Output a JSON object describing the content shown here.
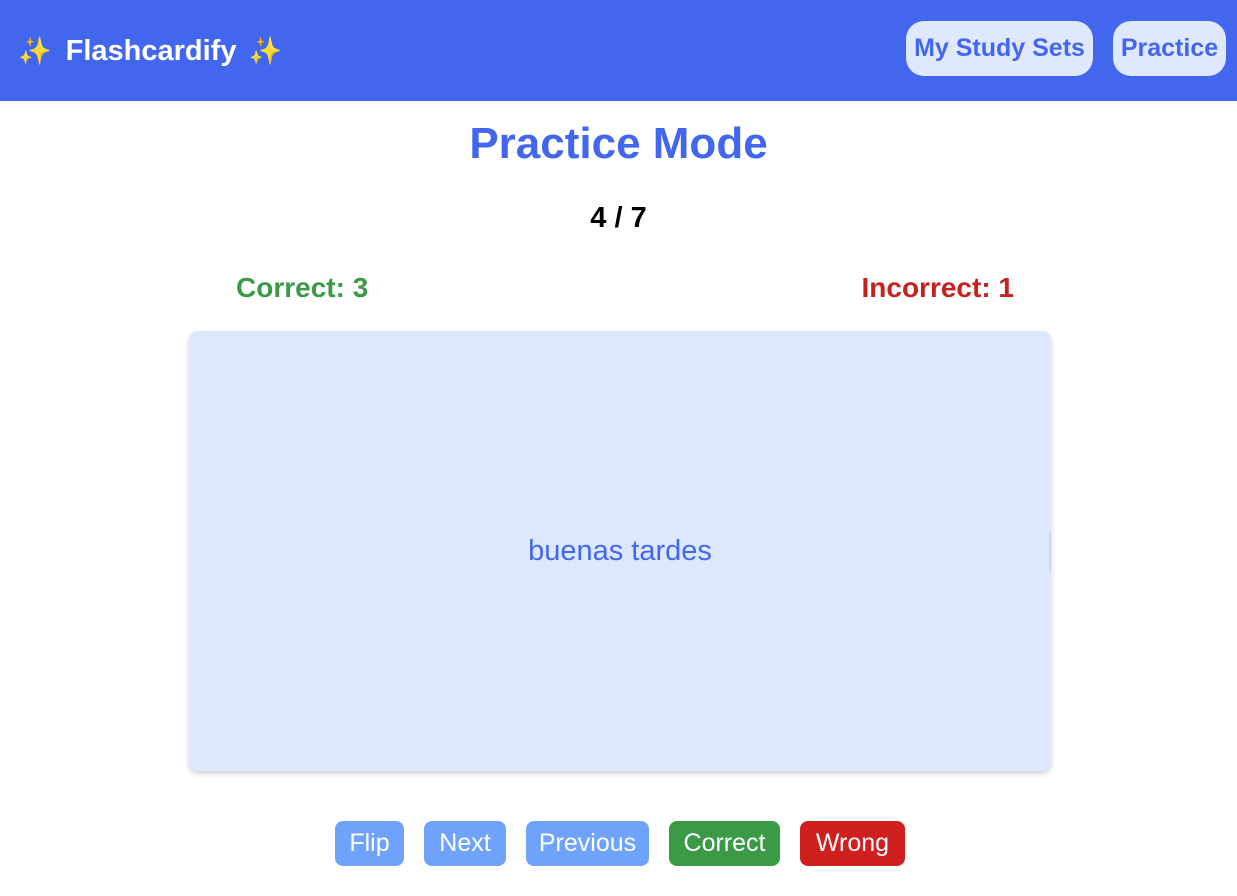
{
  "header": {
    "brand_icon": "sparkles-icon",
    "brand_left_emoji": "✨",
    "brand_name": "Flashcardify",
    "brand_right_emoji": "✨",
    "nav": {
      "study_sets_label": "My Study Sets",
      "practice_label": "Practice"
    }
  },
  "main": {
    "title": "Practice Mode",
    "progress": "4 / 7",
    "correct_label": "Correct: 3",
    "incorrect_label": "Incorrect: 1",
    "card_text": "buenas tardes"
  },
  "controls": {
    "flip_label": "Flip",
    "next_label": "Next",
    "previous_label": "Previous",
    "correct_label": "Correct",
    "wrong_label": "Wrong"
  },
  "colors": {
    "primary": "#4267ee",
    "card_bg": "#dde8fd",
    "correct": "#3a9a45",
    "wrong": "#d01f1f",
    "secondary_button": "#6fa3fb"
  }
}
